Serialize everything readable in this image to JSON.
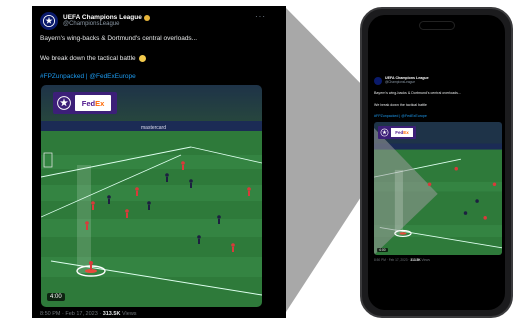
{
  "tweet": {
    "account_name": "UEFA Champions League",
    "handle": "@ChampionsLeague",
    "text_line1": "Bayern's wing-backs & Dortmund's central overloads...",
    "text_line2": "We break down the tactical battle",
    "hashtags": "#FPZunpacked | @FedExEurope",
    "video_time": "4:00",
    "footer_time": "8:50 PM · Feb 17, 2023 · ",
    "footer_views_count": "313.5K",
    "footer_views_label": " Views",
    "more_icon": "···"
  },
  "sponsor": {
    "fed": "Fed",
    "ex": "Ex"
  },
  "icons": {
    "avatar": "starball-icon",
    "verified": "verified-badge-icon",
    "emoji": "thinking-face-icon",
    "more": "more-icon"
  },
  "colors": {
    "link": "#1d9bf0",
    "badge_bg": "#3c1f78",
    "fedex_purple": "#4d148c",
    "fedex_orange": "#ff6600",
    "pitch": "#2e7a3a"
  }
}
